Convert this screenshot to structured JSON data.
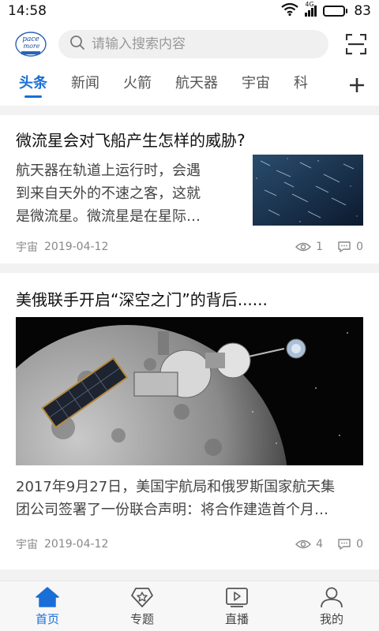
{
  "status_bar": {
    "time": "14:58",
    "network": "4G",
    "battery": "83",
    "battery_level_percent": 83
  },
  "header": {
    "logo_text": "Space More",
    "search_placeholder": "请输入搜索内容"
  },
  "tabs": [
    {
      "label": "头条",
      "active": true
    },
    {
      "label": "新闻",
      "active": false
    },
    {
      "label": "火箭",
      "active": false
    },
    {
      "label": "航天器",
      "active": false
    },
    {
      "label": "宇宙",
      "active": false
    },
    {
      "label": "科",
      "active": false
    }
  ],
  "articles": [
    {
      "title": "微流星会对飞船产生怎样的威胁?",
      "summary_lines": [
        "航天器在轨道上运行时，会遇",
        "到来自天外的不速之客，这就",
        "是微流星。微流星是在星际…"
      ],
      "source": "宇宙",
      "date": "2019-04-12",
      "views": "1",
      "comments": "0",
      "image_icon": "meteor-shower-image"
    },
    {
      "title": "美俄联手开启“深空之门”的背后......",
      "summary_lines": [
        "2017年9月27日，美国宇航局和俄罗斯国家航天集",
        "团公司签署了一份联合声明：将合作建造首个月…"
      ],
      "source": "宇宙",
      "date": "2019-04-12",
      "views": "4",
      "comments": "0",
      "image_icon": "space-station-moon-image"
    }
  ],
  "bottom_nav": [
    {
      "label": "首页",
      "icon": "home-icon",
      "active": true
    },
    {
      "label": "专题",
      "icon": "topic-badge-icon",
      "active": false
    },
    {
      "label": "直播",
      "icon": "live-play-icon",
      "active": false
    },
    {
      "label": "我的",
      "icon": "user-icon",
      "active": false
    }
  ],
  "colors": {
    "accent": "#1a6ed8",
    "text_primary": "#111111",
    "text_meta": "#888888",
    "divider": "#f2f2f2"
  }
}
